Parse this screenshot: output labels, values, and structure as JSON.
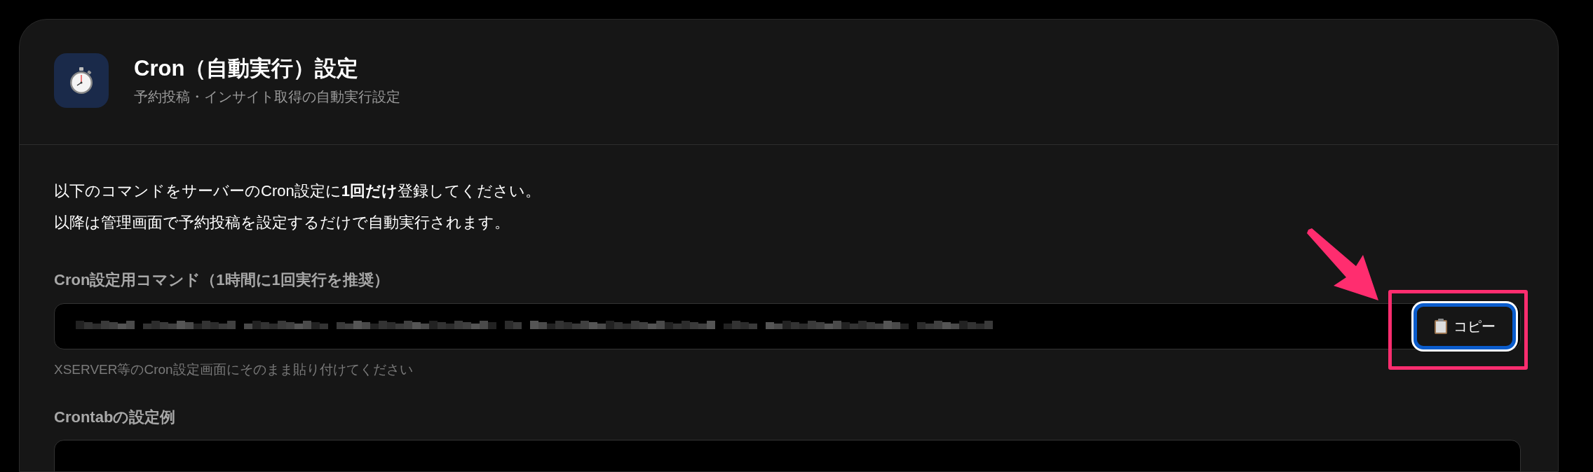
{
  "header": {
    "title": "Cron（自動実行）設定",
    "subtitle": "予約投稿・インサイト取得の自動実行設定"
  },
  "intro": [
    "以下のコマンドをサーバーのCron設定に**1回だけ**登録してください。",
    "以降は管理画面で予約投稿を設定するだけで自動実行されます。"
  ],
  "command": {
    "label": "Cron設定用コマンド（1時間に1回実行を推奨）",
    "copy_button": {
      "label": "コピー",
      "focused": true
    },
    "hint": "XSERVER等のCron設定画面にそのまま貼り付けてください"
  },
  "example": {
    "label": "Crontabの設定例"
  }
}
